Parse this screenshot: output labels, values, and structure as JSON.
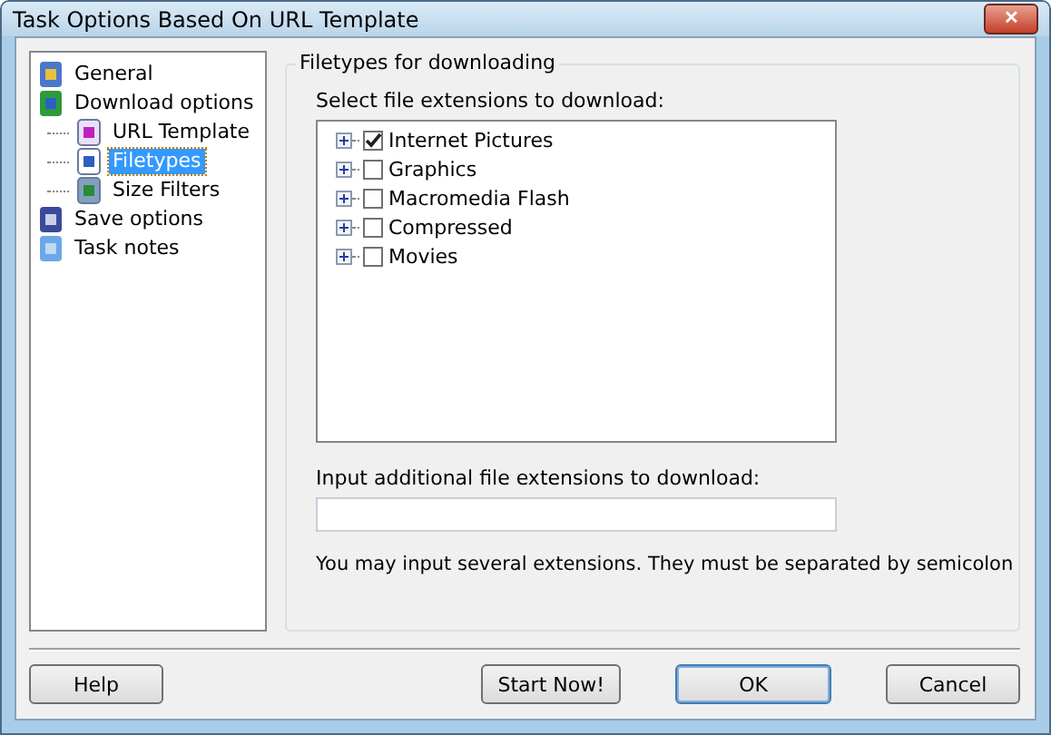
{
  "window": {
    "title": "Task Options Based On URL Template",
    "close": "✕"
  },
  "sidebar": {
    "items": [
      {
        "label": "General",
        "kind": "general",
        "selected": false
      },
      {
        "label": "Download options",
        "kind": "download",
        "selected": false,
        "children": [
          {
            "label": "URL Template",
            "kind": "template",
            "selected": false
          },
          {
            "label": "Filetypes",
            "kind": "filetypes",
            "selected": true
          },
          {
            "label": "Size Filters",
            "kind": "filter",
            "selected": false
          }
        ]
      },
      {
        "label": "Save options",
        "kind": "save",
        "selected": false
      },
      {
        "label": "Task notes",
        "kind": "notes",
        "selected": false
      }
    ]
  },
  "group": {
    "title": "Filetypes for downloading",
    "list_label": "Select file extensions to download:",
    "filetypes": [
      {
        "label": "Internet Pictures",
        "checked": true,
        "expanded": false
      },
      {
        "label": "Graphics",
        "checked": false,
        "expanded": false
      },
      {
        "label": "Macromedia Flash",
        "checked": false,
        "expanded": false
      },
      {
        "label": "Compressed",
        "checked": false,
        "expanded": false
      },
      {
        "label": "Movies",
        "checked": false,
        "expanded": false
      }
    ],
    "input_label": "Input additional file extensions to download:",
    "note": "You may input several extensions. They must be separated by semicolon"
  },
  "buttons": [
    {
      "label": "Help",
      "kind": "left",
      "default": false
    },
    {
      "label": "Start Now!",
      "kind": "right",
      "default": false
    },
    {
      "label": "OK",
      "kind": "right",
      "default": true
    },
    {
      "label": "Cancel",
      "kind": "right",
      "default": false
    }
  ]
}
